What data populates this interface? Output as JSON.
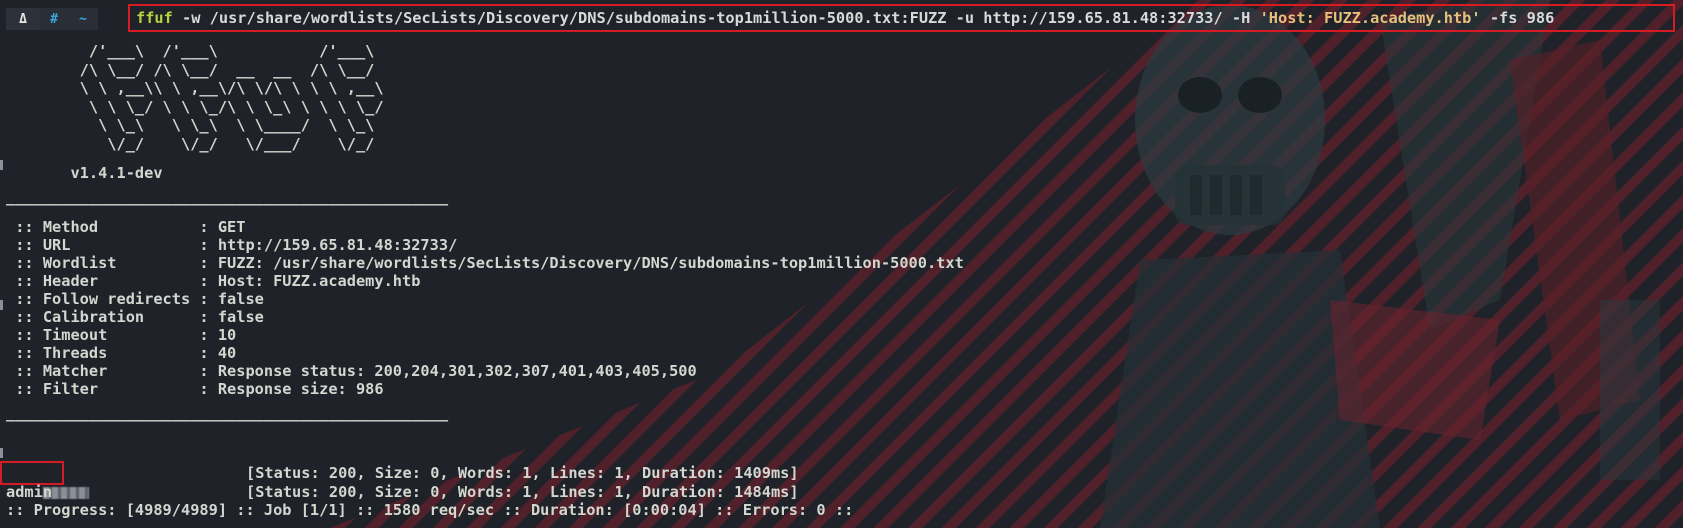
{
  "prompt": {
    "os_glyph": "Δ",
    "hash_glyph": "#",
    "home_glyph": "~"
  },
  "command": {
    "name": "ffuf",
    "args_before": " -w /usr/share/wordlists/SecLists/Discovery/DNS/subdomains-top1million-5000.txt:FUZZ -u http://159.65.81.48:32733/ -H ",
    "header_arg": "'Host: FUZZ.academy.htb'",
    "args_after": " -fs 986"
  },
  "banner": {
    "ascii_art": "         /'___\\  /'___\\           /'___\\\n        /\\ \\__/ /\\ \\__/  __  __  /\\ \\__/\n        \\ \\ ,__\\\\ \\ ,__\\/\\ \\/\\ \\ \\ \\ ,__\\\n         \\ \\ \\_/ \\ \\ \\_/\\ \\ \\_\\ \\ \\ \\ \\_/\n          \\ \\_\\   \\ \\_\\  \\ \\____/  \\ \\_\\\n           \\/_/    \\/_/   \\/___/    \\/_/",
    "version": "       v1.4.1-dev"
  },
  "separator": "________________________________________________",
  "config": [
    {
      "key": " :: Method           ",
      "value": ": GET"
    },
    {
      "key": " :: URL              ",
      "value": ": http://159.65.81.48:32733/"
    },
    {
      "key": " :: Wordlist         ",
      "value": ": FUZZ: /usr/share/wordlists/SecLists/Discovery/DNS/subdomains-top1million-5000.txt"
    },
    {
      "key": " :: Header           ",
      "value": ": Host: FUZZ.academy.htb"
    },
    {
      "key": " :: Follow redirects ",
      "value": ": false"
    },
    {
      "key": " :: Calibration      ",
      "value": ": false"
    },
    {
      "key": " :: Timeout          ",
      "value": ": 10"
    },
    {
      "key": " :: Threads          ",
      "value": ": 40"
    },
    {
      "key": " :: Matcher          ",
      "value": ": Response status: 200,204,301,302,307,401,403,405,500"
    },
    {
      "key": " :: Filter           ",
      "value": ": Response size: 986"
    }
  ],
  "results": [
    {
      "name": "",
      "redacted": true,
      "info": "[Status: 200, Size: 0, Words: 1, Lines: 1, Duration: 1409ms]"
    },
    {
      "name": "admin",
      "redacted": false,
      "info": "[Status: 200, Size: 0, Words: 1, Lines: 1, Duration: 1484ms]"
    }
  ],
  "progress": ":: Progress: [4989/4989] :: Job [1/1] :: 1580 req/sec :: Duration: [0:00:04] :: Errors: 0 ::",
  "colors": {
    "background": "#1f2228",
    "highlight_border": "#d61b24",
    "command_name": "#b7d33f",
    "string_arg": "#e6c07b",
    "prompt_accent": "#3aa8e0"
  }
}
